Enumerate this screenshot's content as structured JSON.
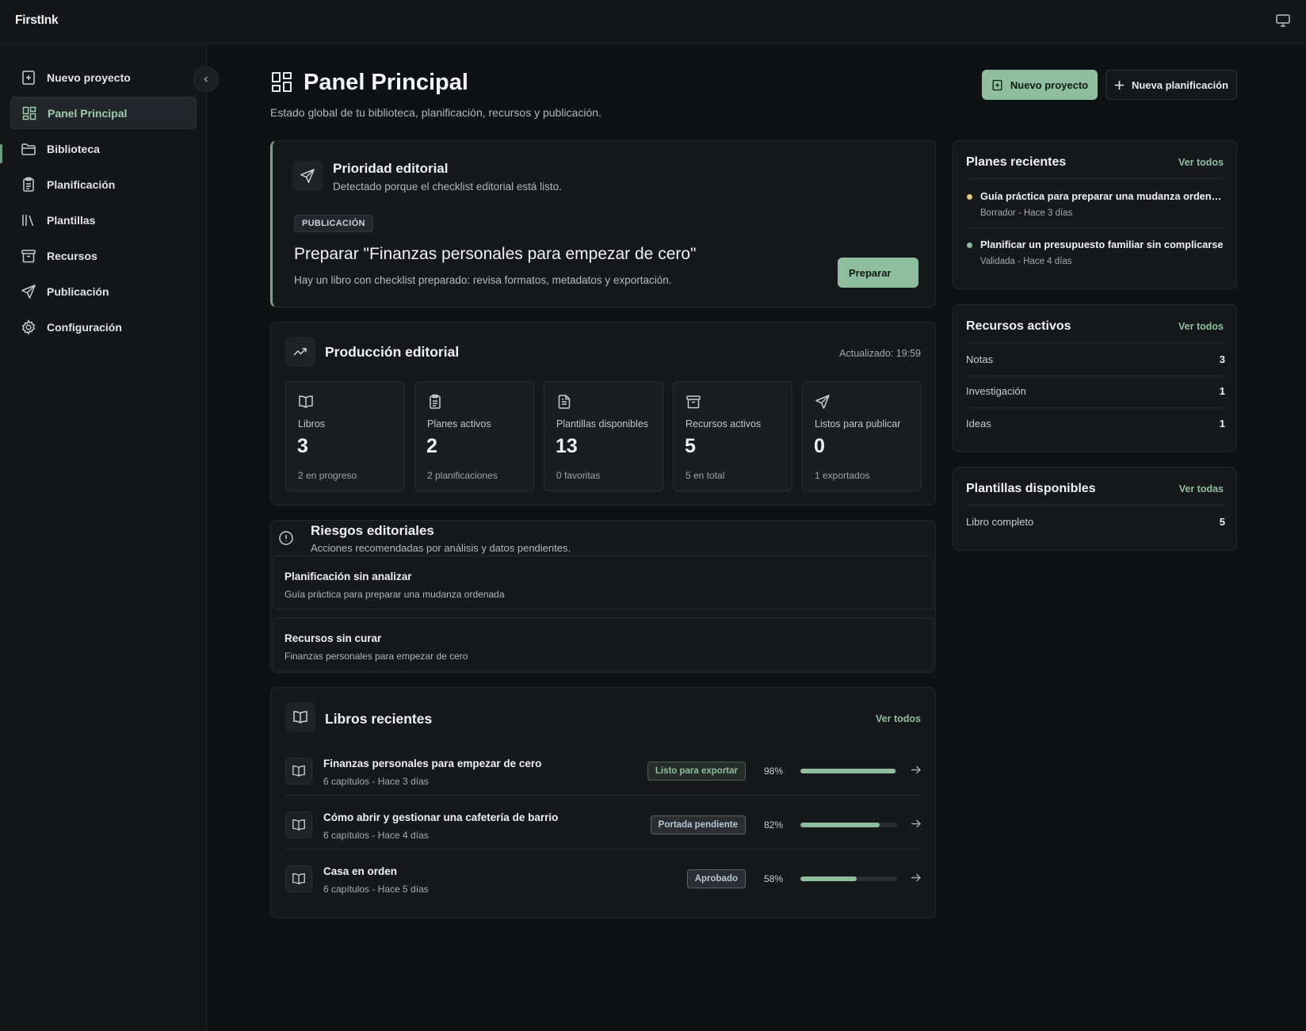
{
  "app": {
    "name": "FirstInk"
  },
  "sidebar": {
    "items": [
      {
        "label": "Nuevo proyecto",
        "icon": "file-plus-icon"
      },
      {
        "label": "Panel Principal",
        "icon": "dashboard-icon",
        "active": true
      },
      {
        "label": "Biblioteca",
        "icon": "folder-icon"
      },
      {
        "label": "Planificación",
        "icon": "clipboard-icon"
      },
      {
        "label": "Plantillas",
        "icon": "library-icon"
      },
      {
        "label": "Recursos",
        "icon": "archive-icon"
      },
      {
        "label": "Publicación",
        "icon": "send-icon"
      },
      {
        "label": "Configuración",
        "icon": "gear-icon"
      }
    ]
  },
  "header": {
    "title": "Panel Principal",
    "subtitle": "Estado global de tu biblioteca, planificación, recursos y publicación.",
    "primary_button": "Nuevo proyecto",
    "secondary_button": "Nueva planificación"
  },
  "priority": {
    "title": "Prioridad editorial",
    "subtitle": "Detectado porque el checklist editorial está listo.",
    "tag": "PUBLICACIÓN",
    "headline": "Preparar \"Finanzas personales para empezar de cero\"",
    "description": "Hay un libro con checklist preparado: revisa formatos, metadatos y exportación.",
    "button": "Preparar"
  },
  "production": {
    "title": "Producción editorial",
    "updated": "Actualizado: 19:59",
    "stats": [
      {
        "label": "Libros",
        "value": "3",
        "sub": "2 en progreso",
        "icon": "book-icon"
      },
      {
        "label": "Planes activos",
        "value": "2",
        "sub": "2 planificaciones",
        "icon": "clipboard-icon"
      },
      {
        "label": "Plantillas disponibles",
        "value": "13",
        "sub": "0 favoritas",
        "icon": "file-text-icon"
      },
      {
        "label": "Recursos activos",
        "value": "5",
        "sub": "5 en total",
        "icon": "archive-icon"
      },
      {
        "label": "Listos para publicar",
        "value": "0",
        "sub": "1 exportados",
        "icon": "send-icon"
      }
    ]
  },
  "risks": {
    "title": "Riesgos editoriales",
    "subtitle": "Acciones recomendadas por análisis y datos pendientes.",
    "items": [
      {
        "title": "Planificación sin analizar",
        "subtitle": "Guía práctica para preparar una mudanza ordenada"
      },
      {
        "title": "Recursos sin curar",
        "subtitle": "Finanzas personales para empezar de cero"
      }
    ]
  },
  "books": {
    "title": "Libros recientes",
    "link": "Ver todos",
    "items": [
      {
        "title": "Finanzas personales para empezar de cero",
        "meta": "6 capítulos - Hace 3 días",
        "status": "Listo para exportar",
        "status_color": "#8fbe9e",
        "percent_label": "98%",
        "progress": 0.98
      },
      {
        "title": "Cómo abrir y gestionar una cafetería de barrio",
        "meta": "6 capítulos - Hace 4 días",
        "status": "Portada pendiente",
        "status_color": "#b9c7d6",
        "percent_label": "82%",
        "progress": 0.82
      },
      {
        "title": "Casa en orden",
        "meta": "6 capítulos - Hace 5 días",
        "status": "Aprobado",
        "status_color": "#b9c7d6",
        "percent_label": "58%",
        "progress": 0.58
      }
    ]
  },
  "recent_plans": {
    "title": "Planes recientes",
    "link": "Ver todos",
    "items": [
      {
        "title": "Guía práctica para preparar una mudanza ordenada",
        "meta": "Borrador - Hace 3 días",
        "dot_color": "#e3c77a"
      },
      {
        "title": "Planificar un presupuesto familiar sin complicarse",
        "meta": "Validada - Hace 4 días",
        "dot_color": "#8fbe9e"
      }
    ]
  },
  "active_resources": {
    "title": "Recursos activos",
    "link": "Ver todos",
    "items": [
      {
        "label": "Notas",
        "value": "3"
      },
      {
        "label": "Investigación",
        "value": "1"
      },
      {
        "label": "Ideas",
        "value": "1"
      }
    ]
  },
  "templates": {
    "title": "Plantillas disponibles",
    "link": "Ver todas",
    "items": [
      {
        "label": "Libro completo",
        "value": "5"
      }
    ]
  },
  "colors": {
    "accent": "#8fbe9e",
    "background": "#101113",
    "card": "#17181b"
  }
}
